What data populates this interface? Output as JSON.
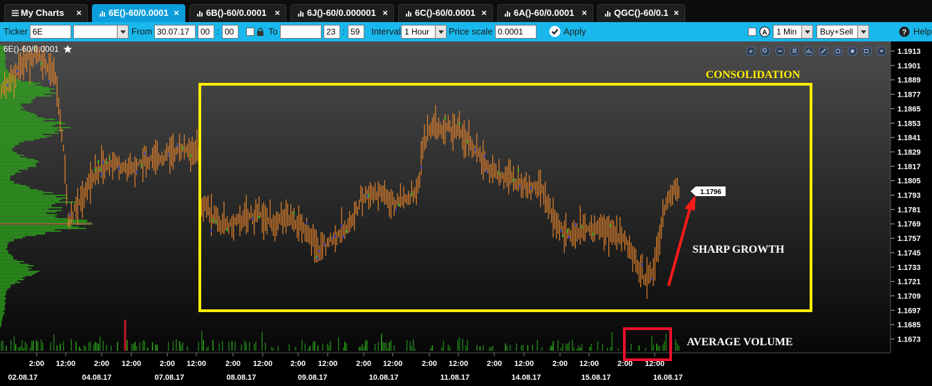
{
  "tabs": [
    {
      "label": "My Charts",
      "active": false,
      "icon": "list-icon"
    },
    {
      "label": "6E()-60/0.0001",
      "active": true,
      "icon": "bar-chart-icon"
    },
    {
      "label": "6B()-60/0.0001",
      "active": false,
      "icon": "bar-chart-icon"
    },
    {
      "label": "6J()-60/0.000001",
      "active": false,
      "icon": "bar-chart-icon"
    },
    {
      "label": "6C()-60/0.0001",
      "active": false,
      "icon": "bar-chart-icon"
    },
    {
      "label": "6A()-60/0.0001",
      "active": false,
      "icon": "bar-chart-icon"
    },
    {
      "label": "QGC()-60/0.1",
      "active": false,
      "icon": "bar-chart-icon"
    }
  ],
  "close_glyph": "×",
  "toolbar": {
    "ticker_label": "Ticker",
    "ticker_value": "6E",
    "from_label": "From",
    "from_date": "30.07.17",
    "from_hour": "00",
    "from_minute": "00",
    "to_label": "To",
    "to_date": "",
    "to_hour": "23",
    "to_minute": "59",
    "time_separator": ":",
    "interval_label": "Interval",
    "interval_value": "1 Hour",
    "price_scale_label": "Price scale",
    "price_scale_value": "0.0001",
    "apply_label": "Apply",
    "timeframe_value": "1 Min",
    "side_value": "Buy+Sell",
    "help_label": "Help"
  },
  "chart": {
    "symbol_title": "6E()-60/0.0001",
    "current_price_label": "1.1796",
    "annotations": {
      "consolidation": "CONSOLIDATION",
      "sharp_growth": "SHARP GROWTH",
      "average_volume": "AVERAGE VOLUME"
    },
    "colors": {
      "candle": "#e8842a",
      "volume_profile": "#2fa81c",
      "consolidation_box": "#ffee00",
      "arrow": "#ff1a1a",
      "volume_box": "#e8102a",
      "toolbar": "#18b8ec",
      "active_tab": "#0b9ddc"
    }
  },
  "chart_data": {
    "type": "candlestick",
    "y_ticks": [
      "1.1913",
      "1.1901",
      "1.1889",
      "1.1877",
      "1.1865",
      "1.1853",
      "1.1841",
      "1.1829",
      "1.1817",
      "1.1805",
      "1.1793",
      "1.1781",
      "1.1769",
      "1.1757",
      "1.1745",
      "1.1733",
      "1.1721",
      "1.1709",
      "1.1697",
      "1.1685",
      "1.1673"
    ],
    "x_time_ticks": [
      "2:00",
      "12:00",
      "2:00",
      "12:00",
      "2:00",
      "12:00",
      "2:00",
      "12:00",
      "2:00",
      "12:00",
      "2:00",
      "12:00",
      "2:00",
      "12:00",
      "2:00",
      "12:00",
      "2:00",
      "12:00",
      "2:00",
      "12:00"
    ],
    "x_date_ticks": [
      "02.08.17",
      "04.08.17",
      "07.08.17",
      "08.08.17",
      "09.08.17",
      "10.08.17",
      "11.08.17",
      "14.08.17",
      "15.08.17",
      "16.08.17"
    ],
    "ylim": [
      1.1667,
      1.1918
    ],
    "last_price": 1.1796,
    "price_path": [
      [
        0,
        1.188
      ],
      [
        14,
        1.1905
      ],
      [
        24,
        1.191
      ],
      [
        34,
        1.189
      ],
      [
        40,
        1.182
      ],
      [
        42,
        1.177
      ],
      [
        50,
        1.179
      ],
      [
        58,
        1.181
      ],
      [
        68,
        1.182
      ],
      [
        78,
        1.1815
      ],
      [
        86,
        1.1818
      ],
      [
        96,
        1.1822
      ],
      [
        108,
        1.183
      ],
      [
        118,
        1.1833
      ],
      [
        124,
        1.183
      ],
      [
        126,
        1.1785
      ],
      [
        132,
        1.1778
      ],
      [
        142,
        1.1766
      ],
      [
        150,
        1.1772
      ],
      [
        160,
        1.1778
      ],
      [
        170,
        1.177
      ],
      [
        180,
        1.1775
      ],
      [
        190,
        1.1766
      ],
      [
        200,
        1.1748
      ],
      [
        210,
        1.1758
      ],
      [
        220,
        1.1773
      ],
      [
        228,
        1.1793
      ],
      [
        238,
        1.1796
      ],
      [
        248,
        1.1787
      ],
      [
        256,
        1.179
      ],
      [
        262,
        1.18
      ],
      [
        266,
        1.184
      ],
      [
        272,
        1.1852
      ],
      [
        280,
        1.1848
      ],
      [
        290,
        1.1845
      ],
      [
        300,
        1.1825
      ],
      [
        310,
        1.1812
      ],
      [
        320,
        1.1806
      ],
      [
        330,
        1.18
      ],
      [
        340,
        1.1798
      ],
      [
        346,
        1.1775
      ],
      [
        356,
        1.176
      ],
      [
        366,
        1.1765
      ],
      [
        376,
        1.1765
      ],
      [
        386,
        1.1763
      ],
      [
        394,
        1.175
      ],
      [
        402,
        1.1732
      ],
      [
        406,
        1.1722
      ],
      [
        410,
        1.173
      ],
      [
        414,
        1.1758
      ],
      [
        418,
        1.179
      ],
      [
        426,
        1.1797
      ]
    ]
  }
}
